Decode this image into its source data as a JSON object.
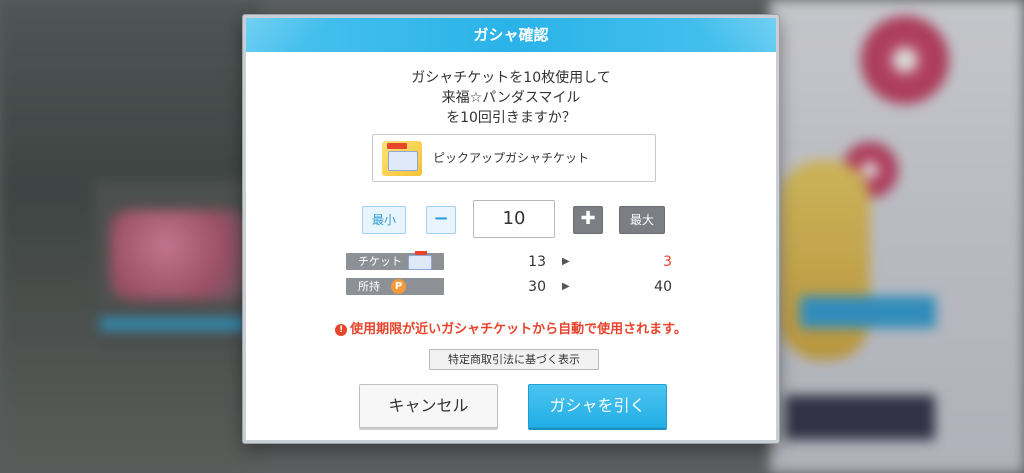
{
  "dialog": {
    "title": "ガシャ確認",
    "message_line1": "ガシャチケットを10枚使用して",
    "message_line2": "来福☆パンダスマイル",
    "message_line3": "を10回引きますか？",
    "item_name": "ピックアップガシャチケット",
    "item_icon": "gacha-ticket-icon"
  },
  "stepper": {
    "min_label": "最小",
    "minus_symbol": "−",
    "quantity": "10",
    "plus_symbol": "✚",
    "max_label": "最大"
  },
  "resources": [
    {
      "label": "チケット",
      "icon": "ticket-icon",
      "before": "13",
      "arrow": "▶",
      "after": "3",
      "after_color": "#e8442c"
    },
    {
      "label": "所持",
      "icon": "p-coin-icon",
      "coin_letter": "P",
      "before": "30",
      "arrow": "▶",
      "after": "40"
    }
  ],
  "warning": {
    "icon_symbol": "!",
    "text": "使用期限が近いガシャチケットから自動で使用されます。",
    "color": "#e8442c"
  },
  "legal_button": "特定商取引法に基づく表示",
  "buttons": {
    "cancel": "キャンセル",
    "draw": "ガシャを引く"
  },
  "colors": {
    "accent": "#2ab3e8",
    "warning": "#e8442c"
  }
}
